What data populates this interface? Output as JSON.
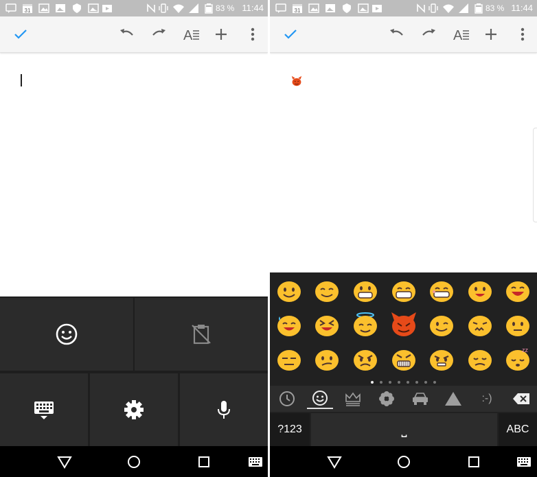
{
  "status_bar": {
    "battery": "83 %",
    "time": "11:44",
    "calendar_day": "31"
  },
  "toolbar": {
    "icons": [
      "check-icon",
      "undo-icon",
      "redo-icon",
      "text-format-icon",
      "plus-icon",
      "more-vertical-icon"
    ]
  },
  "left_keyboard_menu": {
    "tiles": [
      "emoji-icon",
      "clipboard-off-icon",
      "keyboard-icon",
      "gear-icon",
      "microphone-icon"
    ]
  },
  "emoji_keyboard": {
    "categories": [
      "recent-clock-icon",
      "smiley-face-icon",
      "crown-icon",
      "flower-icon",
      "car-icon",
      "triangle-icon",
      "emoticon",
      "backspace-icon"
    ],
    "emoticon_label": ":-)",
    "symbols_key": "?123",
    "space_key": "⎵",
    "abc_key": "ABC",
    "page_dots": 8,
    "active_page": 0
  },
  "navigation": {
    "buttons": [
      "back-icon",
      "home-icon",
      "recents-icon",
      "keyboard-switch-icon"
    ]
  },
  "colors": {
    "accent": "#2196f3",
    "emoji_yellow": "#fbc02d",
    "devil_red": "#e64a19"
  }
}
